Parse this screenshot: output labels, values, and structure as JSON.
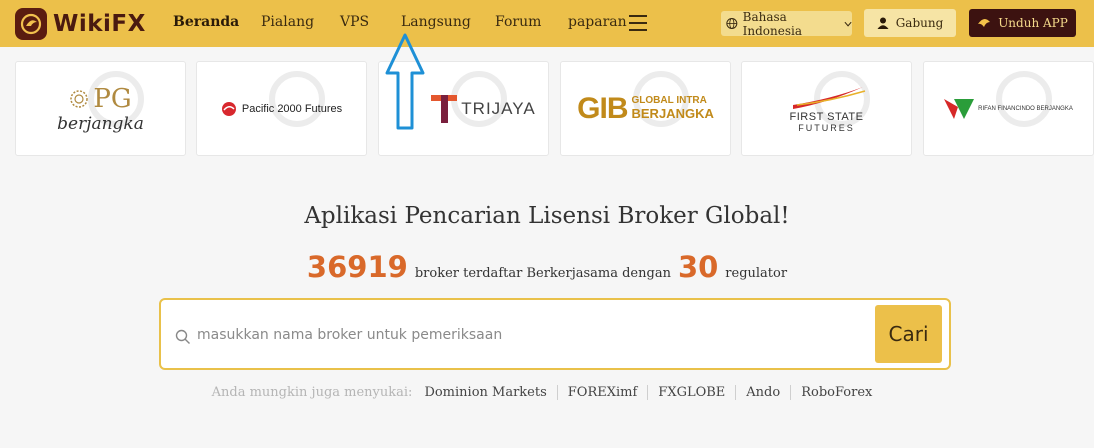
{
  "brand": {
    "name": "WikiFX"
  },
  "nav": {
    "items": [
      {
        "label": "Beranda",
        "active": true
      },
      {
        "label": "Pialang"
      },
      {
        "label": "VPS"
      },
      {
        "label": "Langsung"
      },
      {
        "label": "Forum"
      },
      {
        "label": "paparan"
      }
    ],
    "language": "Bahasa Indonesia",
    "join": "Gabung",
    "download": "Unduh APP"
  },
  "brokers": [
    {
      "line1": "PG",
      "line2": "berjangka"
    },
    {
      "name": "Pacific 2000 Futures"
    },
    {
      "name": "TRIJAYA"
    },
    {
      "line1": "GIB",
      "line2a": "GLOBAL INTRA",
      "line2b": "BERJANGKA"
    },
    {
      "line1": "FIRST STATE",
      "line2": "FUTURES"
    },
    {
      "name": "RIFAN FINANCINDO BERJANGKA"
    }
  ],
  "hero": {
    "headline": "Aplikasi Pencarian Lisensi Broker Global!",
    "broker_count": "36919",
    "broker_text": "broker terdaftar Berkerjasama dengan",
    "regulator_count": "30",
    "regulator_text": "regulator"
  },
  "search": {
    "placeholder": "masukkan nama broker untuk pemeriksaan",
    "value": "",
    "button": "Cari"
  },
  "suggestions": {
    "label": "Anda mungkin juga menyukai:",
    "items": [
      "Dominion Markets",
      "FOREXimf",
      "FXGLOBE",
      "Ando",
      "RoboForex"
    ]
  },
  "colors": {
    "accent": "#ecc04a",
    "brand_dark": "#3c1210",
    "number": "#d9692a",
    "annotation": "#1e90d6"
  }
}
